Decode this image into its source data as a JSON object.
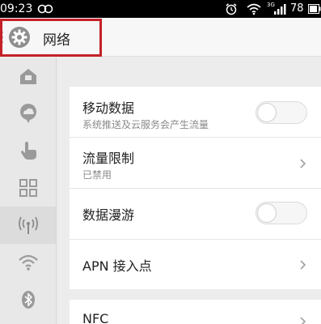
{
  "status_bar": {
    "time": "09:23",
    "network_type": "3G",
    "battery": "78"
  },
  "header": {
    "title": "网络",
    "icon": "gear-icon"
  },
  "sidebar": {
    "items": [
      {
        "icon": "home-icon",
        "active": false
      },
      {
        "icon": "cloud-chat-icon",
        "active": false
      },
      {
        "icon": "hand-pointer-icon",
        "active": false
      },
      {
        "icon": "grid-apps-icon",
        "active": false
      },
      {
        "icon": "antenna-icon",
        "active": true
      },
      {
        "icon": "wifi-icon",
        "active": false
      },
      {
        "icon": "bluetooth-icon",
        "active": false
      }
    ]
  },
  "settings": {
    "mobile_data": {
      "title": "移动数据",
      "subtitle": "系统推送及云服务会产生流量",
      "enabled": false
    },
    "traffic_limit": {
      "title": "流量限制",
      "subtitle": "已禁用"
    },
    "data_roaming": {
      "title": "数据漫游",
      "enabled": false
    },
    "apn": {
      "title": "APN 接入点"
    },
    "nfc": {
      "title": "NFC"
    }
  },
  "colors": {
    "highlight_border": "#c42128",
    "sidebar_bg": "#e8e8e8",
    "card_bg": "#ffffff"
  }
}
